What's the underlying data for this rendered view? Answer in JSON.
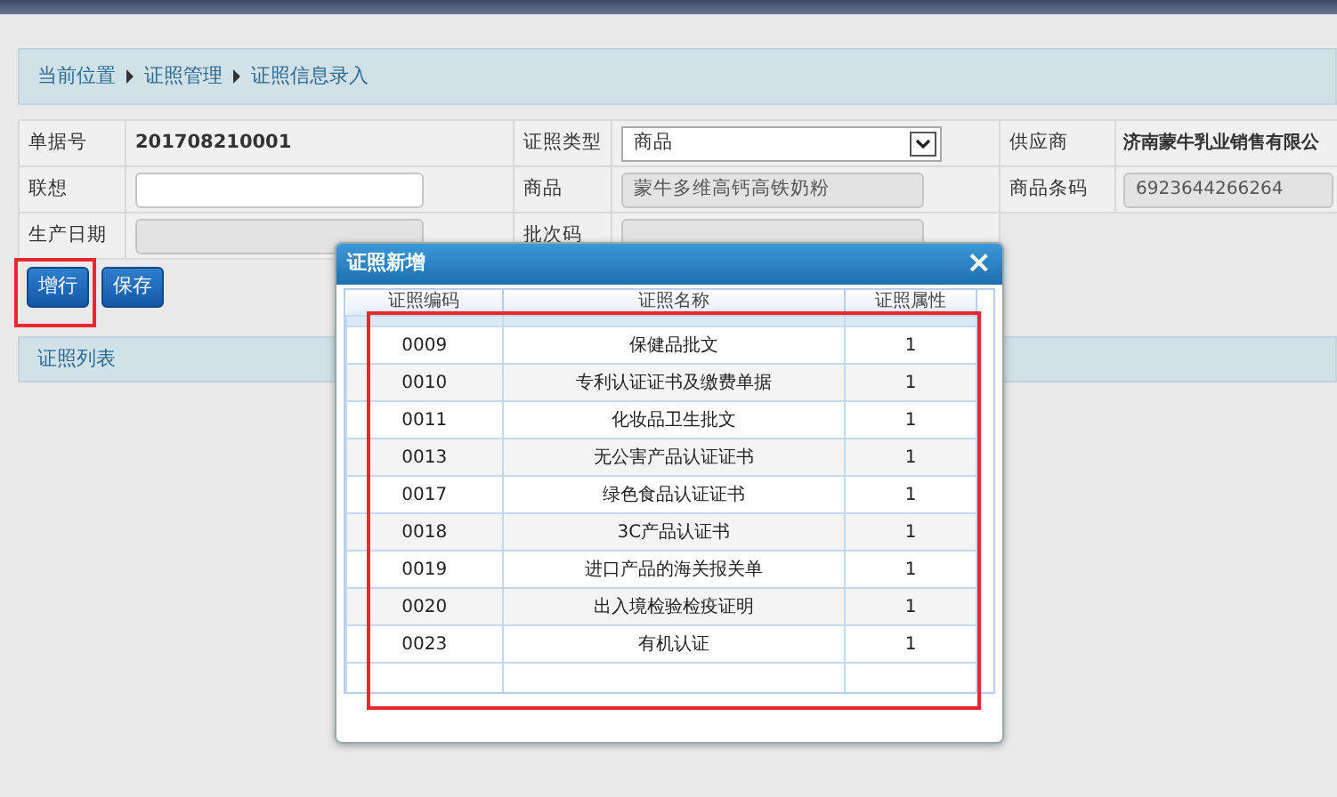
{
  "breadcrumb": [
    "当前位置",
    "证照管理",
    "证照信息录入"
  ],
  "form": {
    "rows": [
      [
        {
          "label": "单据号"
        },
        {
          "kind": "text",
          "value": "201708210001"
        },
        {
          "label": "证照类型"
        },
        {
          "kind": "select",
          "value": "商品"
        },
        {
          "label": "供应商"
        },
        {
          "kind": "text",
          "value": "济南蒙牛乳业销售有限公"
        }
      ],
      [
        {
          "label": "联想"
        },
        {
          "kind": "input",
          "disabled": false
        },
        {
          "label": "商品"
        },
        {
          "kind": "input",
          "value": "蒙牛多维高钙高铁奶粉",
          "disabled": true
        },
        {
          "label": "商品条码"
        },
        {
          "kind": "input",
          "value": "6923644266264",
          "disabled": true
        }
      ],
      [
        {
          "label": "生产日期"
        },
        {
          "kind": "input",
          "disabled": true
        },
        {
          "label": "批次码"
        },
        {
          "kind": "input",
          "disabled": true
        }
      ]
    ]
  },
  "buttons": [
    {
      "label": "增行",
      "highlighted": true
    },
    {
      "label": "保存",
      "highlighted": false
    }
  ],
  "list_panel": {
    "title": "证照列表"
  },
  "dialog": {
    "title": "证照新增",
    "close": "×",
    "highlighted": true,
    "columns": [
      "证照编码",
      "证照名称",
      "证照属性"
    ],
    "rows": [
      [
        "0009",
        "保健品批文",
        "1"
      ],
      [
        "0010",
        "专利认证证书及缴费单据",
        "1"
      ],
      [
        "0011",
        "化妆品卫生批文",
        "1"
      ],
      [
        "0013",
        "无公害产品认证证书",
        "1"
      ],
      [
        "0017",
        "绿色食品认证证书",
        "1"
      ],
      [
        "0018",
        "3C产品认证书",
        "1"
      ],
      [
        "0019",
        "进口产品的海关报关单",
        "1"
      ],
      [
        "0020",
        "出入境检验检疫证明",
        "1"
      ],
      [
        "0023",
        "有机认证",
        "1"
      ]
    ]
  }
}
